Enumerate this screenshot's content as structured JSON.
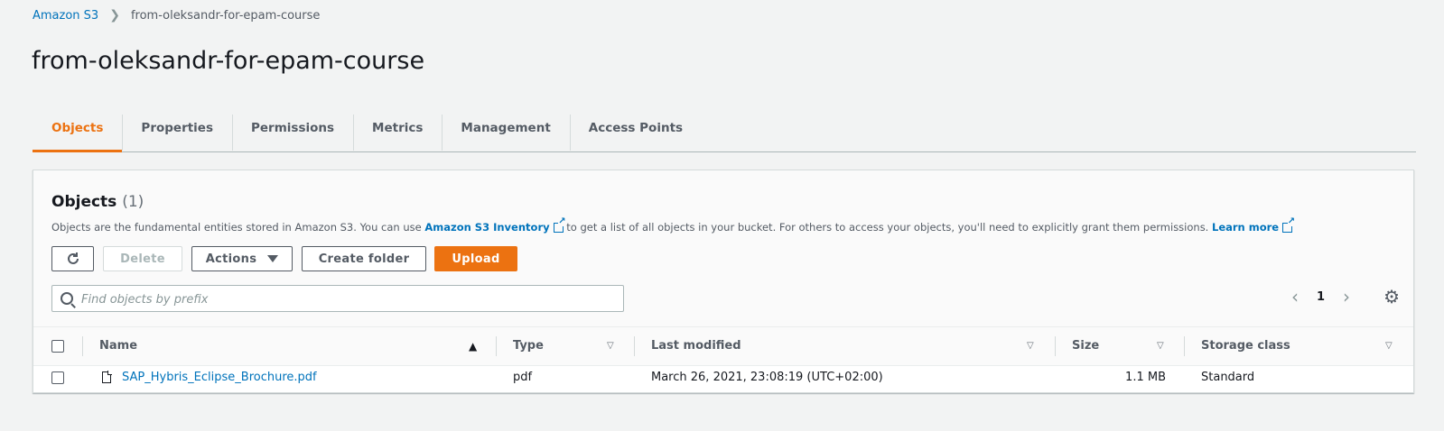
{
  "breadcrumb": {
    "root": "Amazon S3",
    "current": "from-oleksandr-for-epam-course"
  },
  "page_title": "from-oleksandr-for-epam-course",
  "tabs": [
    "Objects",
    "Properties",
    "Permissions",
    "Metrics",
    "Management",
    "Access Points"
  ],
  "active_tab": "Objects",
  "objects_panel": {
    "title": "Objects",
    "count": "(1)",
    "description_pre": "Objects are the fundamental entities stored in Amazon S3. You can use ",
    "description_link": "Amazon S3 Inventory",
    "description_mid": " to get a list of all objects in your bucket. For others to access your objects, you'll need to explicitly grant them permissions. ",
    "learn_more": "Learn more",
    "buttons": {
      "delete": "Delete",
      "actions": "Actions",
      "create_folder": "Create folder",
      "upload": "Upload"
    },
    "search_placeholder": "Find objects by prefix",
    "page_number": "1"
  },
  "table": {
    "columns": [
      "Name",
      "Type",
      "Last modified",
      "Size",
      "Storage class"
    ],
    "rows": [
      {
        "name": "SAP_Hybris_Eclipse_Brochure.pdf",
        "type": "pdf",
        "last_modified": "March 26, 2021, 23:08:19 (UTC+02:00)",
        "size": "1.1 MB",
        "storage_class": "Standard"
      }
    ]
  },
  "colors": {
    "accent": "#ec7211",
    "link": "#0073bb"
  },
  "icons": {
    "refresh": "refresh-icon",
    "search": "search-icon",
    "settings": "gear-icon",
    "file": "file-icon"
  }
}
